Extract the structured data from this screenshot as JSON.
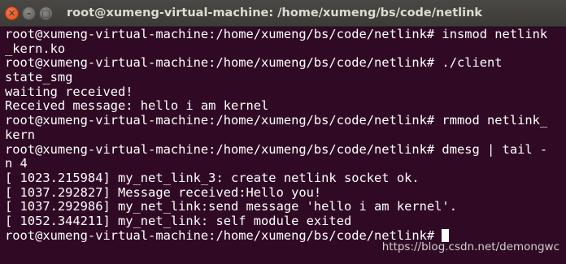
{
  "window": {
    "title": "root@xumeng-virtual-machine: /home/xumeng/bs/code/netlink",
    "close_glyph": "✕",
    "minimize_glyph": "–",
    "maximize_glyph": "□"
  },
  "terminal": {
    "lines": [
      "root@xumeng-virtual-machine:/home/xumeng/bs/code/netlink# insmod netlink",
      "_kern.ko",
      "root@xumeng-virtual-machine:/home/xumeng/bs/code/netlink# ./client",
      "state_smg",
      "waiting received!",
      "Received message: hello i am kernel",
      "root@xumeng-virtual-machine:/home/xumeng/bs/code/netlink# rmmod netlink_",
      "kern",
      "root@xumeng-virtual-machine:/home/xumeng/bs/code/netlink# dmesg | tail -",
      "n 4",
      "[ 1023.215984] my_net_link_3: create netlink socket ok.",
      "[ 1037.292827] Message received:Hello you!",
      "[ 1037.292986] my_net_link:send message 'hello i am kernel'.",
      "[ 1052.344211] my_net_link: self module exited",
      "root@xumeng-virtual-machine:/home/xumeng/bs/code/netlink# "
    ]
  },
  "watermark": {
    "text": "https://blog.csdn.net/demongwc"
  },
  "colors": {
    "background": "#300a24",
    "text": "#ffffff",
    "titlebar": "#3c3b37",
    "close_button": "#df4a16"
  }
}
